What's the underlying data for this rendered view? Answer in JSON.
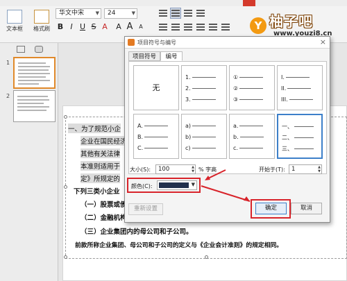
{
  "ribbon": {
    "font_name": "华文中宋",
    "font_size": "24",
    "textbox_label": "文本框",
    "format_label": "格式刷",
    "format_buttons": [
      "B",
      "I",
      "U",
      "S",
      "A",
      "A",
      "A",
      "A"
    ]
  },
  "brand": {
    "icon_letter": "Y",
    "name": "柚子吧",
    "url": "www.youzi8.cn"
  },
  "thumbnails": [
    "1",
    "2"
  ],
  "document": {
    "lines": [
      "一、为了规范小企",
      "企业在国民经济",
      "其他有关法律",
      "本准则适用于",
      "定》所规定的",
      "下列三类小企业",
      "（一）股票或债",
      "（二）金融机构",
      "（三）企业集团内的母公司和子公司。",
      "前款所称企业集团、母公司和子公司的定义与《企业会计准则》的规定相同。"
    ]
  },
  "dialog": {
    "title": "项目符号与编号",
    "close": "×",
    "tabs": [
      "项目符号",
      "编号"
    ],
    "active_tab": 1,
    "none_label": "无",
    "styles": [
      [
        "1.",
        "2.",
        "3."
      ],
      [
        "①",
        "②",
        "③"
      ],
      [
        "I.",
        "II.",
        "III."
      ],
      [
        "A.",
        "B.",
        "C."
      ],
      [
        "a)",
        "b)",
        "c)"
      ],
      [
        "a.",
        "b.",
        "c."
      ],
      [
        "一、",
        "二、",
        "三、"
      ]
    ],
    "selected_style": 6,
    "size_label": "大小(S):",
    "size_value": "100",
    "size_unit": "% 字高",
    "start_label": "开始于(T):",
    "start_value": "1",
    "color_label": "颜色(C):",
    "color_value": "#22304d",
    "reset_button": "重新设置",
    "ok_button": "确定",
    "cancel_button": "取消"
  }
}
